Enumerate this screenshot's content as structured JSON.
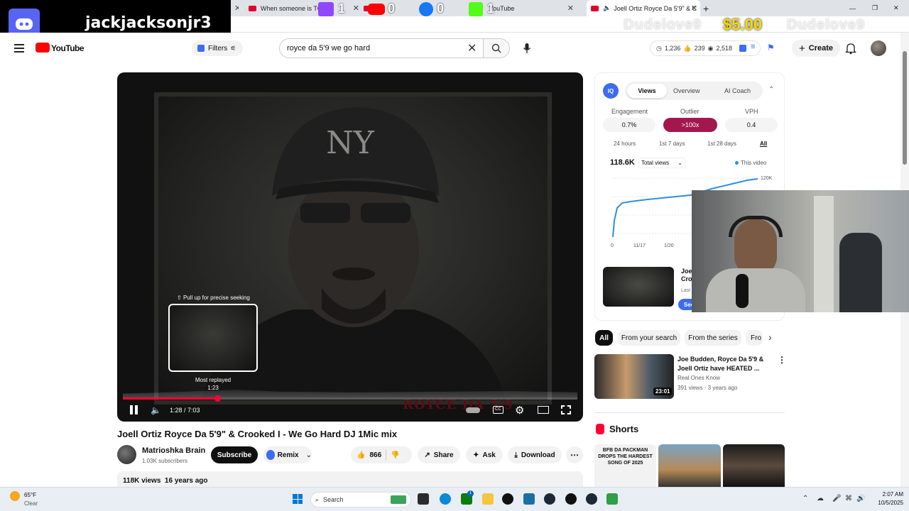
{
  "browser": {
    "tabs": [
      {
        "label": "When someone is TOO...",
        "active": false
      },
      {
        "label": "YouTube",
        "active": false
      },
      {
        "label": "Joell Ortiz Royce Da 5'9\" & C",
        "active": true
      }
    ],
    "new_tab": "+",
    "window_controls": [
      "—",
      "❐",
      "✕"
    ]
  },
  "stream_overlay": {
    "username": "jackjacksonjr3",
    "counts": {
      "twitch": "1",
      "youtube": "0",
      "facebook": "0",
      "kick": "1"
    },
    "donation_amount": "$5.00",
    "donation_ticker": "Dudelove9",
    "donation_ticker_2": "Dudelove9"
  },
  "header": {
    "logo": "YouTube",
    "filters_label": "Filters",
    "search_value": "royce da 5'9 we go hard",
    "stats": {
      "views": "1,236",
      "likes": "239",
      "watch": "2,518"
    },
    "create_label": "Create"
  },
  "player": {
    "seek_hint": "Pull up for precise seeking",
    "most_replayed_label": "Most replayed",
    "most_replayed_time": "1:23",
    "time_current": "1:28",
    "time_total": "7:03",
    "time_display": "1:28 / 7:03",
    "progress_fraction": 0.208,
    "watermark": "ROYCE DA 5'9"
  },
  "video": {
    "title": "Joell Ortiz Royce Da 5'9\" & Crooked I - We Go Hard DJ 1Mic mix",
    "channel": "Matrioshka Brain",
    "subscribers": "1.03K subscribers",
    "subscribe_label": "Subscribe",
    "remix_label": "Remix",
    "likes": "866",
    "share_label": "Share",
    "ask_label": "Ask",
    "download_label": "Download",
    "views_line": "118K views  16 years ago"
  },
  "iq_panel": {
    "tabs": [
      "Views",
      "Overview",
      "AI Coach"
    ],
    "metric_labels": [
      "Engagement",
      "Outlier",
      "VPH"
    ],
    "metric_values": [
      "0.7%",
      ">100x",
      "0.4"
    ],
    "ranges": [
      "24 hours",
      "1st 7 days",
      "1st 28 days",
      "All"
    ],
    "total": "118.6K",
    "select_label": "Total views",
    "legend": "This video",
    "y_tick_top": "120K",
    "x_ticks": [
      "0",
      "11/17",
      "1/20"
    ],
    "related_title": "Joe",
    "related_title_2": "Cro",
    "related_meta": "Last",
    "see_label": "See"
  },
  "chips": [
    "All",
    "From your search",
    "From the series",
    "Fro"
  ],
  "recommended": {
    "title": "Joe Budden, Royce Da 5'9 & Joell Ortiz have HEATED ...",
    "channel": "Real Ones Know",
    "meta": "391 views · 3 years ago",
    "duration": "23:01"
  },
  "shorts": {
    "heading": "Shorts",
    "first_caption": "BFB DA PACKMAN DROPS THE HARDEST SONG OF 2025"
  },
  "taskbar": {
    "weather_temp": "65°F",
    "weather_desc": "Clear",
    "search_label": "Search",
    "time": "2:07 AM",
    "date": "10/5/2025",
    "store_badge": "1"
  },
  "colors": {
    "youtube_red": "#ff0000",
    "iq_accent": "#3d6cf0",
    "outlier_bg": "#a3174f",
    "progress_red": "#ff0033"
  }
}
